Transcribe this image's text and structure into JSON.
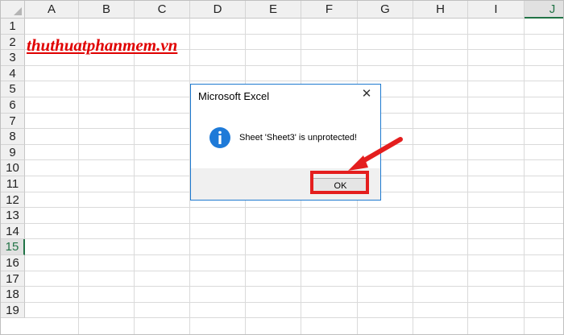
{
  "spreadsheet": {
    "columns": [
      "A",
      "B",
      "C",
      "D",
      "E",
      "F",
      "G",
      "H",
      "I",
      "J"
    ],
    "active_column": "J",
    "rows": [
      "1",
      "2",
      "3",
      "4",
      "5",
      "6",
      "7",
      "8",
      "9",
      "10",
      "11",
      "12",
      "13",
      "14",
      "15",
      "16",
      "17",
      "18",
      "19"
    ],
    "active_row": "15",
    "cells": {
      "A2": "thuthuatphanmem.vn"
    }
  },
  "dialog": {
    "title": "Microsoft Excel",
    "message": "Sheet 'Sheet3' is unprotected!",
    "ok_label": "OK",
    "icon": "info-icon",
    "close_icon": "close-icon"
  },
  "annotation": {
    "color": "#e41e1e"
  }
}
